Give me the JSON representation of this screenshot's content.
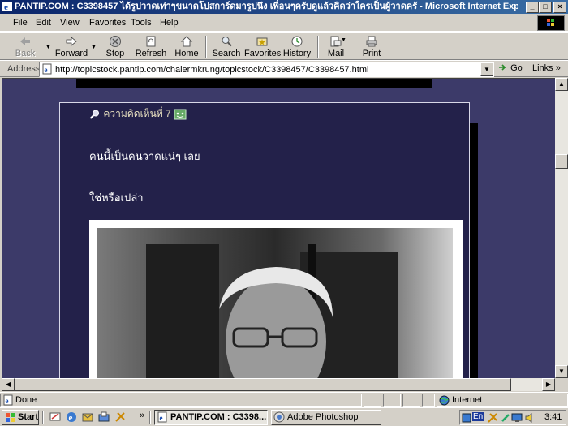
{
  "window": {
    "title": "PANTIP.COM : C3398457 ได้รูปวาดเท่าๆขนาดโปสการ์ดมารูปนึง เพื่อนๆครับดูแล้วคิดว่าใครเป็นผู้วาดครั - Microsoft Internet Explorer",
    "minimize": "_",
    "maximize": "□",
    "close": "×"
  },
  "menu": {
    "file": "File",
    "edit": "Edit",
    "view": "View",
    "favorites": "Favorites",
    "tools": "Tools",
    "help": "Help"
  },
  "toolbar": {
    "back": "Back",
    "forward": "Forward",
    "stop": "Stop",
    "refresh": "Refresh",
    "home": "Home",
    "search": "Search",
    "favorites": "Favorites",
    "history": "History",
    "mail": "Mail",
    "print": "Print"
  },
  "address": {
    "label": "Address",
    "url": "http://topicstock.pantip.com/chalermkrung/topicstock/C3398457/C3398457.html",
    "go": "Go",
    "links": "Links",
    "links_arrow": "»"
  },
  "page": {
    "comment_header": "ความคิดเห็นที่ 7",
    "line1": "คนนี้เป็นคนวาดแน่ๆ เลย",
    "line2": "ใช่หรือเปล่า"
  },
  "status": {
    "text": "Done",
    "zone": "Internet"
  },
  "taskbar": {
    "start": "Start",
    "quicklaunch_more": "»",
    "task1": "PANTIP.COM : C3398...",
    "task2": "Adobe Photoshop",
    "lang": "En",
    "clock": "3:41"
  }
}
